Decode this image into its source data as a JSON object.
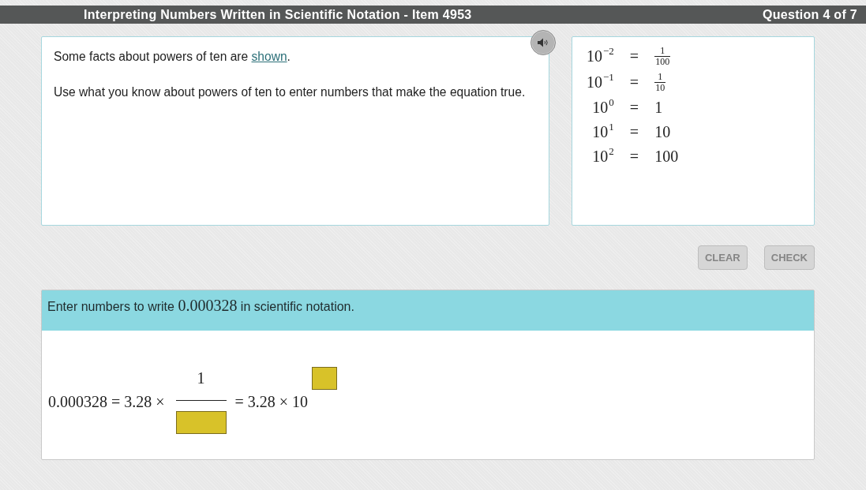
{
  "header": {
    "title": "Interpreting Numbers Written in Scientific Notation - Item 4953",
    "progress": "Question 4 of 7"
  },
  "prompt": {
    "audio_button": true,
    "paragraphs": [
      {
        "kind": "with-link",
        "before": "Some facts about powers of ten are ",
        "link": "shown",
        "after": "."
      },
      {
        "kind": "plain",
        "text": "Use what you know about powers of ten to enter numbers that make the equation true."
      }
    ]
  },
  "facts": {
    "rows": [
      {
        "kind": "fraction",
        "base": "10",
        "exponent": "−2",
        "sign": "=",
        "numerator": "1",
        "denominator": "100"
      },
      {
        "kind": "fraction",
        "base": "10",
        "exponent": "−1",
        "sign": "=",
        "numerator": "1",
        "denominator": "10"
      },
      {
        "kind": "whole",
        "base": "10",
        "exponent": "0",
        "sign": "=",
        "value": "1"
      },
      {
        "kind": "whole",
        "base": "10",
        "exponent": "1",
        "sign": "=",
        "value": "10"
      },
      {
        "kind": "whole",
        "base": "10",
        "exponent": "2",
        "sign": "=",
        "value": "100"
      }
    ]
  },
  "buttons": [
    {
      "label": "CLEAR",
      "disabled": true
    },
    {
      "label": "CHECK",
      "disabled": true
    }
  ],
  "task": {
    "instruction": {
      "before": "Enter numbers to write ",
      "number": "0.000328",
      "after": " in scientific notation."
    },
    "equation": [
      {
        "kind": "text",
        "text": "0.000328 = 3.28 ×"
      },
      {
        "kind": "fraction-blank-denominator",
        "numerator": "1"
      },
      {
        "kind": "text",
        "text": "= 3.28 × 10"
      },
      {
        "kind": "exponent-blank"
      }
    ]
  }
}
